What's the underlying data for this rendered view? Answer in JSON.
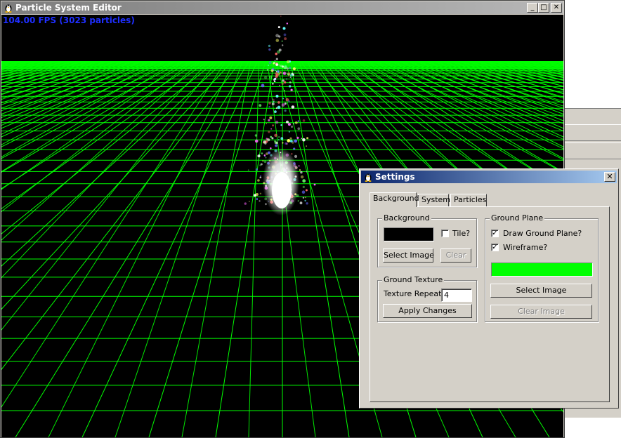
{
  "main_window": {
    "title": "Particle System Editor",
    "title_buttons": {
      "minimize": "_",
      "maximize": "□",
      "close": "✕"
    },
    "fps_overlay": "104.00 FPS (3023 particles)"
  },
  "settings_dialog": {
    "title": "Settings",
    "close_label": "✕",
    "tabs": [
      {
        "label": "Background",
        "selected": true
      },
      {
        "label": "System",
        "selected": false
      },
      {
        "label": "Particles",
        "selected": false
      }
    ],
    "background_group": {
      "label": "Background",
      "color": "#000000",
      "tile_label": "Tile?",
      "tile_checked": false,
      "select_image_label": "Select Image",
      "clear_label": "Clear"
    },
    "ground_texture_group": {
      "label": "Ground Texture",
      "texture_repeat_label": "Texture Repeat:",
      "texture_repeat_value": "4",
      "apply_label": "Apply Changes"
    },
    "ground_plane_group": {
      "label": "Ground Plane",
      "draw_label": "Draw Ground Plane?",
      "draw_checked": true,
      "wireframe_label": "Wireframe?",
      "wireframe_checked": true,
      "color": "#00ff00",
      "select_image_label": "Select Image",
      "clear_image_label": "Clear Image"
    }
  },
  "colors": {
    "grid": "#00ff00",
    "fps_text": "#1f2fff",
    "active_title_start": "#0a246a",
    "active_title_end": "#a6caf0"
  }
}
